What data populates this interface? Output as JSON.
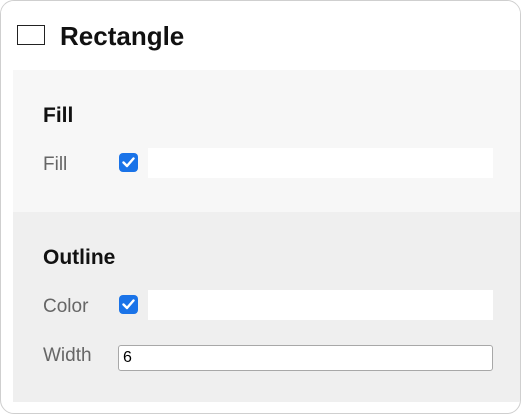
{
  "header": {
    "icon": "rectangle-icon",
    "title": "Rectangle"
  },
  "fill_section": {
    "title": "Fill",
    "fill_label": "Fill",
    "fill_checked": true
  },
  "outline_section": {
    "title": "Outline",
    "color_label": "Color",
    "color_checked": true,
    "width_label": "Width",
    "width_value": "6"
  },
  "colors": {
    "accent": "#1a73e8",
    "checkmark": "#ffffff"
  }
}
